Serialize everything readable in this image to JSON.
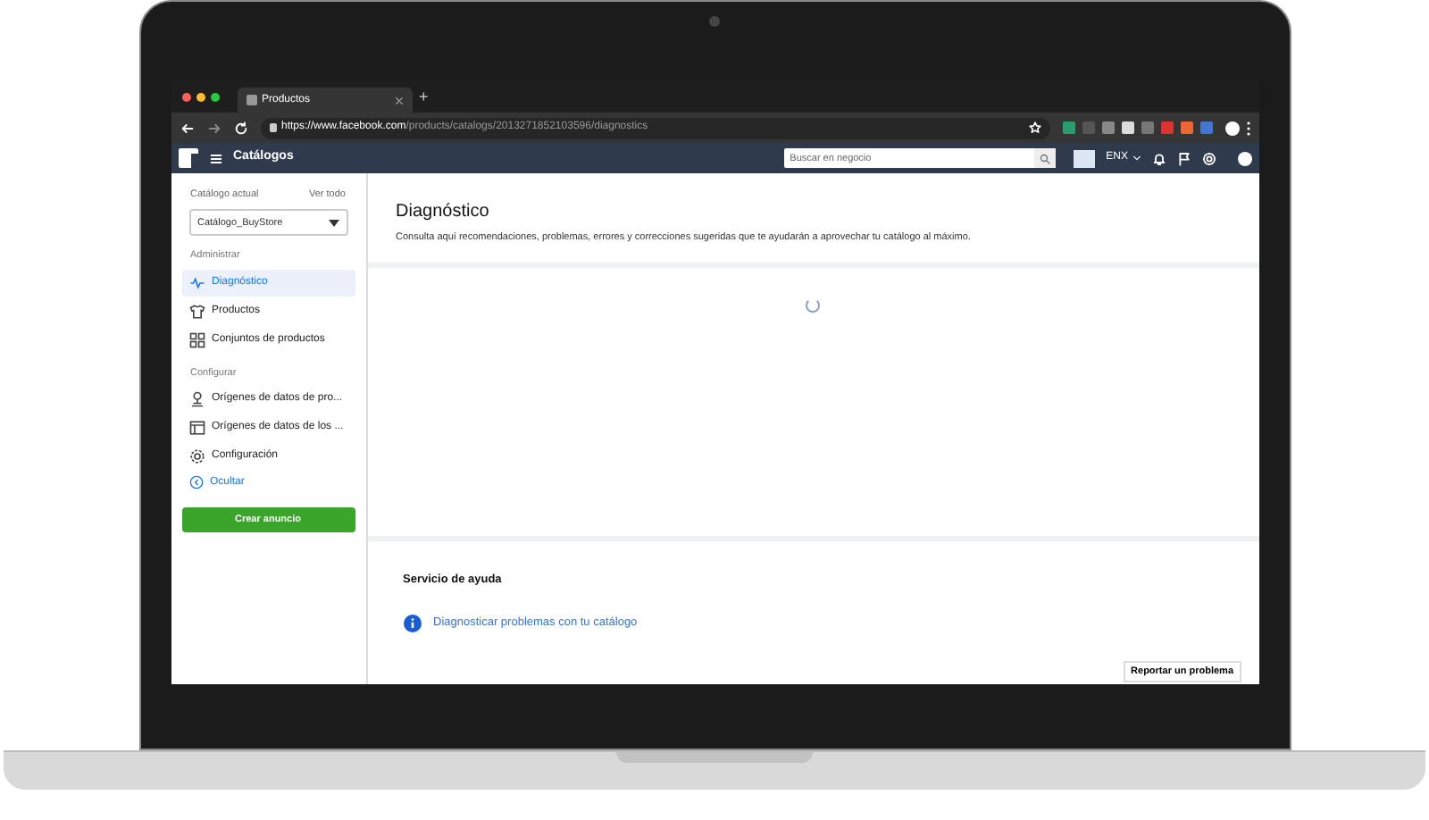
{
  "browser": {
    "tab": {
      "title": "Productos"
    },
    "new_tab": "+",
    "url": {
      "host": "https://www.facebook.com",
      "path": "/products/catalogs/201327185210359​6/diagnostics"
    }
  },
  "topbar": {
    "title": "Catálogos",
    "search": {
      "placeholder": "Buscar en negocio"
    },
    "account": "ENX"
  },
  "sidebar": {
    "catalog_label": "Catálogo actual",
    "see_all": "Ver todo",
    "catalog_select": "Catálogo_BuyStore",
    "sections": [
      {
        "title": "Administrar",
        "items": [
          {
            "label": "Diagnóstico",
            "selected": true
          },
          {
            "label": "Productos",
            "selected": false
          },
          {
            "label": "Conjuntos de productos",
            "selected": false
          }
        ]
      },
      {
        "title": "Configurar",
        "items": [
          {
            "label": "Orígenes de datos de pro...",
            "selected": false
          },
          {
            "label": "Orígenes de datos de los ...",
            "selected": false
          },
          {
            "label": "Configuración",
            "selected": false
          }
        ]
      }
    ],
    "hide": "Ocultar",
    "create_button": "Crear anuncio"
  },
  "main": {
    "title": "Diagnóstico",
    "subtitle": "Consulta aquí recomendaciones, problemas, errores y correcciones sugeridas que te ayudarán a aprovechar tu catálogo al máximo.",
    "loading": true,
    "help": {
      "title": "Servicio de ayuda",
      "link": "Diagnosticar problemas con tu catálogo"
    },
    "report_button": "Reportar un problema"
  }
}
